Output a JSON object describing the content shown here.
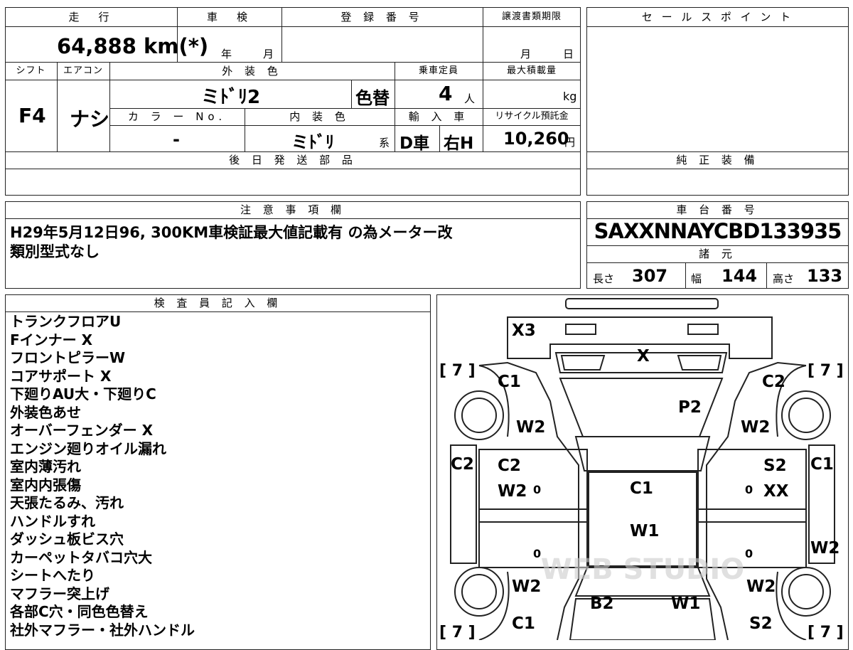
{
  "header": {
    "mileage_label": "走　行",
    "inspection_label": "車　検",
    "registration_label": "登 録 番 号",
    "transfer_deadline_label": "譲渡書類期限",
    "sales_point_label": "セ ー ル ス ポ イ ン ト",
    "mileage_value": "64,888 km(*)",
    "inspection_year": "年",
    "inspection_month": "月",
    "registration_value": "",
    "transfer_month": "月",
    "transfer_day": "日"
  },
  "spec": {
    "shift_label": "シフト",
    "aircon_label": "エアコン",
    "exterior_color_label": "外 装 色",
    "capacity_label": "乗車定員",
    "max_load_label": "最大積載量",
    "shift_value": "F4",
    "aircon_value": "ナシ",
    "exterior_color_value": "ミﾄﾞﾘ2",
    "color_change": "色替",
    "capacity_value": "4",
    "capacity_unit": "人",
    "max_load_unit": "kg",
    "color_no_label": "カ ラ ー No.",
    "interior_color_label": "内 装 色",
    "import_label": "輸 入 車",
    "recycle_label": "リサイクル預託金",
    "color_no_value": "-",
    "interior_color_value": "ミﾄﾞﾘ",
    "interior_suffix": "系",
    "import_type": "D車",
    "steering": "右H",
    "recycle_value": "10,260",
    "recycle_unit": "円"
  },
  "later_parts_label": "後 日 発 送 部 品",
  "genuine_equipment_label": "純 正 装 備",
  "notes": {
    "label": "注 意 事 項 欄",
    "lines": [
      "H29年5月12日96, 300KM車検証最大値記載有 の為メーター改",
      "類別型式なし"
    ]
  },
  "chassis": {
    "label": "車 台 番 号",
    "value": "SAXXNNAYCBD133935",
    "dims_label": "諸 元",
    "length_label": "長さ",
    "length_value": "307",
    "width_label": "幅",
    "width_value": "144",
    "height_label": "高さ",
    "height_value": "133"
  },
  "inspector": {
    "label": "検 査 員 記 入 欄",
    "lines": [
      "トランクフロアU",
      "Fインナー X",
      "フロントピラーW",
      "コアサポート X",
      "下廻りAU大・下廻りC",
      "外装色あせ",
      "オーバーフェンダー X",
      "エンジン廻りオイル漏れ",
      "室内薄汚れ",
      "室内内張傷",
      "天張たるみ、汚れ",
      "ハンドルすれ",
      "ダッシュ板ビス穴",
      "カーペットタバコ穴大",
      "シートへたり",
      "マフラー突上げ",
      "各部C穴・同色色替え",
      "社外マフラー・社外ハンドル"
    ]
  },
  "diagram": {
    "marks": {
      "rear_bumper": "X3",
      "trunk": "X",
      "tire_left_rear": "[ 7 ]",
      "tire_right_rear": "[ 7 ]",
      "tire_left_front": "[ 7 ]",
      "tire_right_front": "[ 7 ]",
      "rear_fender_left": "C1",
      "rear_fender_right": "C2",
      "rear_glass": "P2",
      "rear_fender_left_w": "W2",
      "rear_fender_right_w": "W2",
      "quarter_left": "C2",
      "quarter_right": "C1",
      "door_left_1": "C2",
      "door_left_2": "W2",
      "door_right_1": "S2",
      "door_right_2": "XX",
      "roof": "C1",
      "windshield_area": "W1",
      "side_left_low": "W2",
      "front_fender_left_w": "W2",
      "front_fender_right_w": "W2",
      "hood_left": "B2",
      "hood_right": "W1",
      "front_left": "C1",
      "front_right": "S2",
      "zero": "0"
    },
    "watermark": "WEB STUDIO"
  }
}
